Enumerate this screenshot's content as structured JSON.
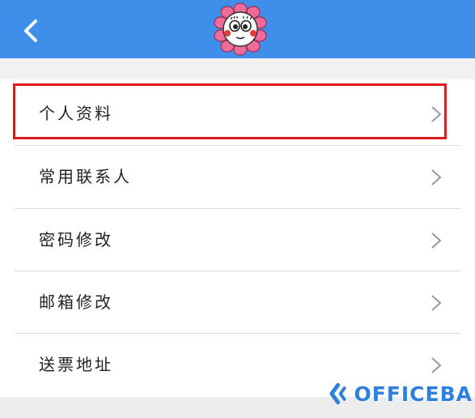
{
  "header": {
    "back_icon": "chevron-left-icon",
    "avatar_icon": "flower-face-icon",
    "bg_color": "#3f8ee9"
  },
  "menu": {
    "items": [
      {
        "label": "个人资料",
        "icon": "chevron-right-icon",
        "highlighted": true
      },
      {
        "label": "常用联系人",
        "icon": "chevron-right-icon"
      },
      {
        "label": "密码修改",
        "icon": "chevron-right-icon"
      },
      {
        "label": "邮箱修改",
        "icon": "chevron-right-icon"
      },
      {
        "label": "送票地址",
        "icon": "chevron-right-icon"
      }
    ]
  },
  "highlight_color": "#e0191c",
  "watermark": {
    "text": "OFFICEBA",
    "color": "#2f7fe0"
  }
}
